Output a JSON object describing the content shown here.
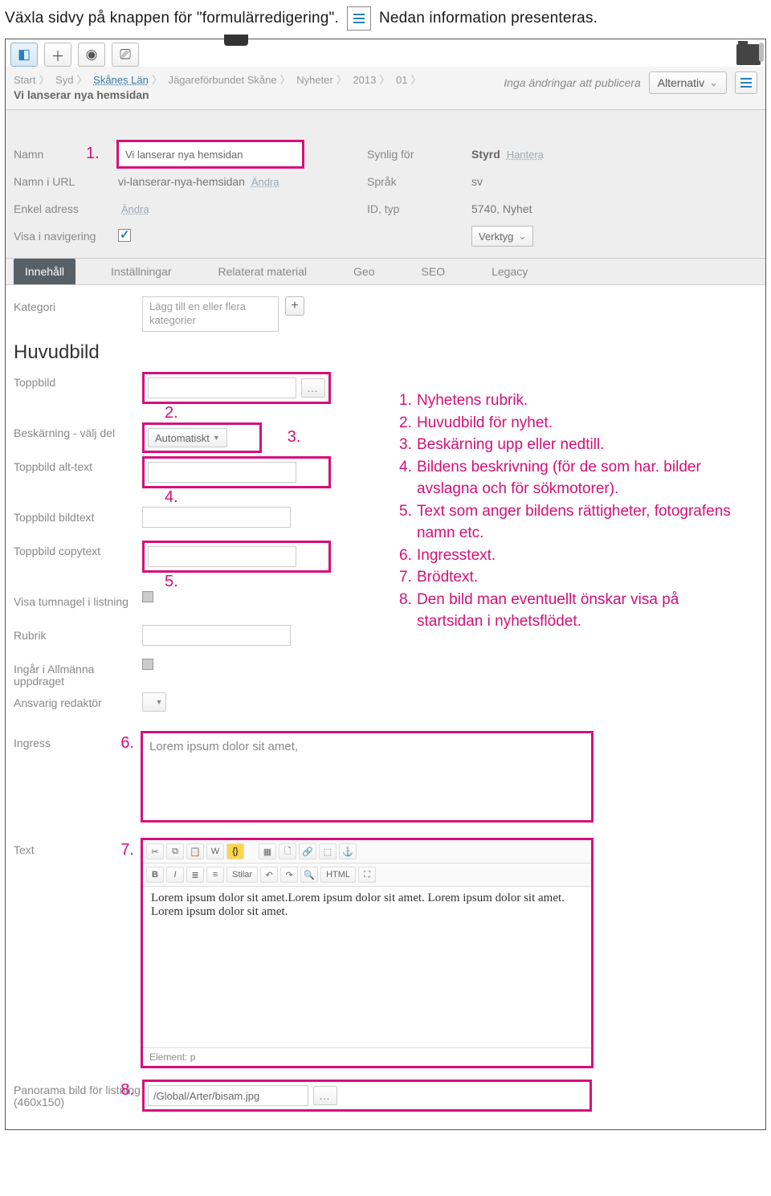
{
  "intro": {
    "before": "Växla sidvy på knappen för \"formulärredigering\".",
    "after": "Nedan information presenteras."
  },
  "toolbar": {
    "alternativ": "Alternativ"
  },
  "breadcrumbs": [
    "Start",
    "Syd",
    "Skånes Län",
    "Jägareförbundet Skåne",
    "Nyheter",
    "2013",
    "01"
  ],
  "page_title": "Vi lanserar nya hemsidan",
  "publish_status": "Inga ändringar att publicera",
  "header": {
    "namn_label": "Namn",
    "namn_value": "Vi lanserar nya hemsidan",
    "namn_url_label": "Namn i URL",
    "namn_url_value": "vi-lanserar-nya-hemsidan",
    "andra": "Ändra",
    "enkel_adress_label": "Enkel adress",
    "visa_nav_label": "Visa i navigering",
    "synlig_label": "Synlig för",
    "synlig_value": "Styrd",
    "hantera": "Hantera",
    "sprak_label": "Språk",
    "sprak_value": "sv",
    "idtyp_label": "ID, typ",
    "idtyp_value": "5740, Nyhet",
    "verktyg": "Verktyg"
  },
  "tabs": [
    "Innehåll",
    "Inställningar",
    "Relaterat material",
    "Geo",
    "SEO",
    "Legacy"
  ],
  "content": {
    "kategori_label": "Kategori",
    "kategori_placeholder": "Lägg till en eller flera kategorier",
    "huvudbild_heading": "Huvudbild",
    "toppbild_label": "Toppbild",
    "beskarning_label": "Beskärning - välj del",
    "beskarning_value": "Automatiskt",
    "alttext_label": "Toppbild alt-text",
    "bildtext_label": "Toppbild bildtext",
    "copytext_label": "Toppbild copytext",
    "tumnagel_label": "Visa tumnagel i listning",
    "rubrik_label": "Rubrik",
    "allman_label": "Ingår i Allmänna uppdraget",
    "redaktor_label": "Ansvarig redaktör",
    "ingress_label": "Ingress",
    "ingress_value": "Lorem ipsum dolor sit amet,",
    "text_label": "Text",
    "rte_styles": "Stilar",
    "rte_html": "HTML",
    "rte_body": "Lorem ipsum dolor sit amet.Lorem ipsum dolor sit amet. Lorem ipsum dolor sit amet. Lorem ipsum dolor sit amet.",
    "rte_status": "Element: p",
    "panorama_label": "Panorama bild för listning (460x150)",
    "panorama_value": "/Global/Arter/bisam.jpg"
  },
  "callouts": {
    "1": "Nyhetens rubrik.",
    "2": "Huvudbild för nyhet.",
    "3": "Beskärning upp eller nedtill.",
    "4": "Bildens beskrivning (för de som har. bilder avslagna och för sökmotorer).",
    "5": "Text som anger bildens rättigheter, fotografens namn etc.",
    "6": "Ingresstext.",
    "7": "Brödtext.",
    "8": "Den bild man eventuellt önskar visa på startsidan i nyhetsflödet."
  }
}
